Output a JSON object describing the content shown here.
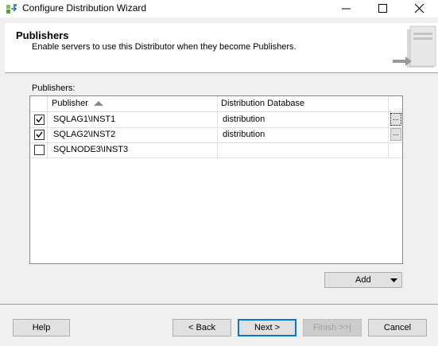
{
  "window": {
    "title": "Configure Distribution Wizard",
    "controls": [
      "minimize-icon",
      "maximize-icon",
      "close-icon"
    ]
  },
  "header": {
    "title": "Publishers",
    "subtitle": "Enable servers to use this Distributor when they become Publishers."
  },
  "grid": {
    "label": "Publishers:",
    "columns": [
      "",
      "Publisher",
      "Distribution Database"
    ],
    "sort_column": "Publisher",
    "sort_direction": "ascending",
    "rows": [
      {
        "checked": true,
        "publisher": "SQLAG1\\INST1",
        "database": "distribution",
        "has_browse": true,
        "browse_label": "...",
        "browse_focused": true
      },
      {
        "checked": true,
        "publisher": "SQLAG2\\INST2",
        "database": "distribution",
        "has_browse": true,
        "browse_label": "...",
        "browse_focused": false
      },
      {
        "checked": false,
        "publisher": "SQLNODE3\\INST3",
        "database": "",
        "has_browse": false
      }
    ]
  },
  "add_button": {
    "label": "Add",
    "icon": "dropdown-arrow-icon"
  },
  "buttons": {
    "help": "Help",
    "back": "< Back",
    "next": "Next >",
    "finish": "Finish >>|",
    "cancel": "Cancel"
  },
  "colors": {
    "focus_border": "#0078d7",
    "disabled_text": "#a0a0a0"
  }
}
